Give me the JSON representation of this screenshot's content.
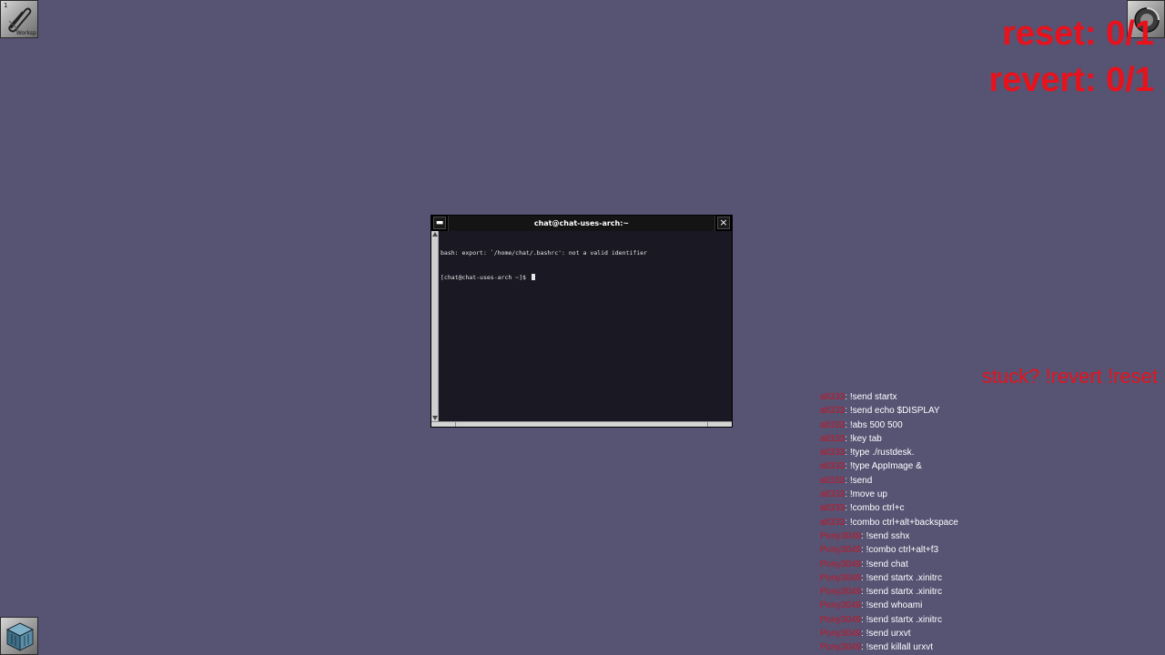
{
  "desktop": {
    "background_color": "#565373",
    "workspace_icon": {
      "number": "1",
      "label": "Worksp"
    }
  },
  "overlay": {
    "accent_color": "#e8121c",
    "reset": "reset: 0/1",
    "revert": "revert: 0/1",
    "hint": "stuck? !revert !reset"
  },
  "terminal": {
    "title": "chat@chat-uses-arch:~",
    "close_glyph": "×",
    "miniaturize_glyph": "▬",
    "lines": [
      "bash: export: `/home/chat/.bashrc': not a valid identifier",
      "[chat@chat-uses-arch ~]$ "
    ]
  },
  "chat": {
    "user_color": "#c41628",
    "messages": [
      {
        "user": "alt333",
        "text": "!send startx"
      },
      {
        "user": "alt333",
        "text": "!send echo $DISPLAY"
      },
      {
        "user": "alt333",
        "text": "!abs 500 500"
      },
      {
        "user": "alt333",
        "text": "!key tab"
      },
      {
        "user": "alt333",
        "text": "!type ./rustdesk."
      },
      {
        "user": "alt333",
        "text": "!type AppImage &"
      },
      {
        "user": "alt333",
        "text": "!send"
      },
      {
        "user": "alt333",
        "text": "!move up"
      },
      {
        "user": "alt333",
        "text": "!combo ctrl+c"
      },
      {
        "user": "alt333",
        "text": "!combo ctrl+alt+backspace"
      },
      {
        "user": "Pony3049",
        "text": "!send sshx"
      },
      {
        "user": "Pony3049",
        "text": "!combo ctrl+alt+f3"
      },
      {
        "user": "Pony3049",
        "text": "!send chat"
      },
      {
        "user": "Pony3049",
        "text": "!send startx .xinitrc"
      },
      {
        "user": "Pony3049",
        "text": "!send startx .xinitrc"
      },
      {
        "user": "Pony3049",
        "text": "!send whoami"
      },
      {
        "user": "Pony3049",
        "text": "!send startx .xinitrc"
      },
      {
        "user": "Pony3049",
        "text": "!send urxvt"
      },
      {
        "user": "Pony3049",
        "text": "!send killall urxvt"
      }
    ]
  },
  "icons": {
    "workspace": "paperclip-workspace-icon",
    "recycle": "recycle-icon",
    "terminal_launcher": "cube-terminal-icon"
  }
}
